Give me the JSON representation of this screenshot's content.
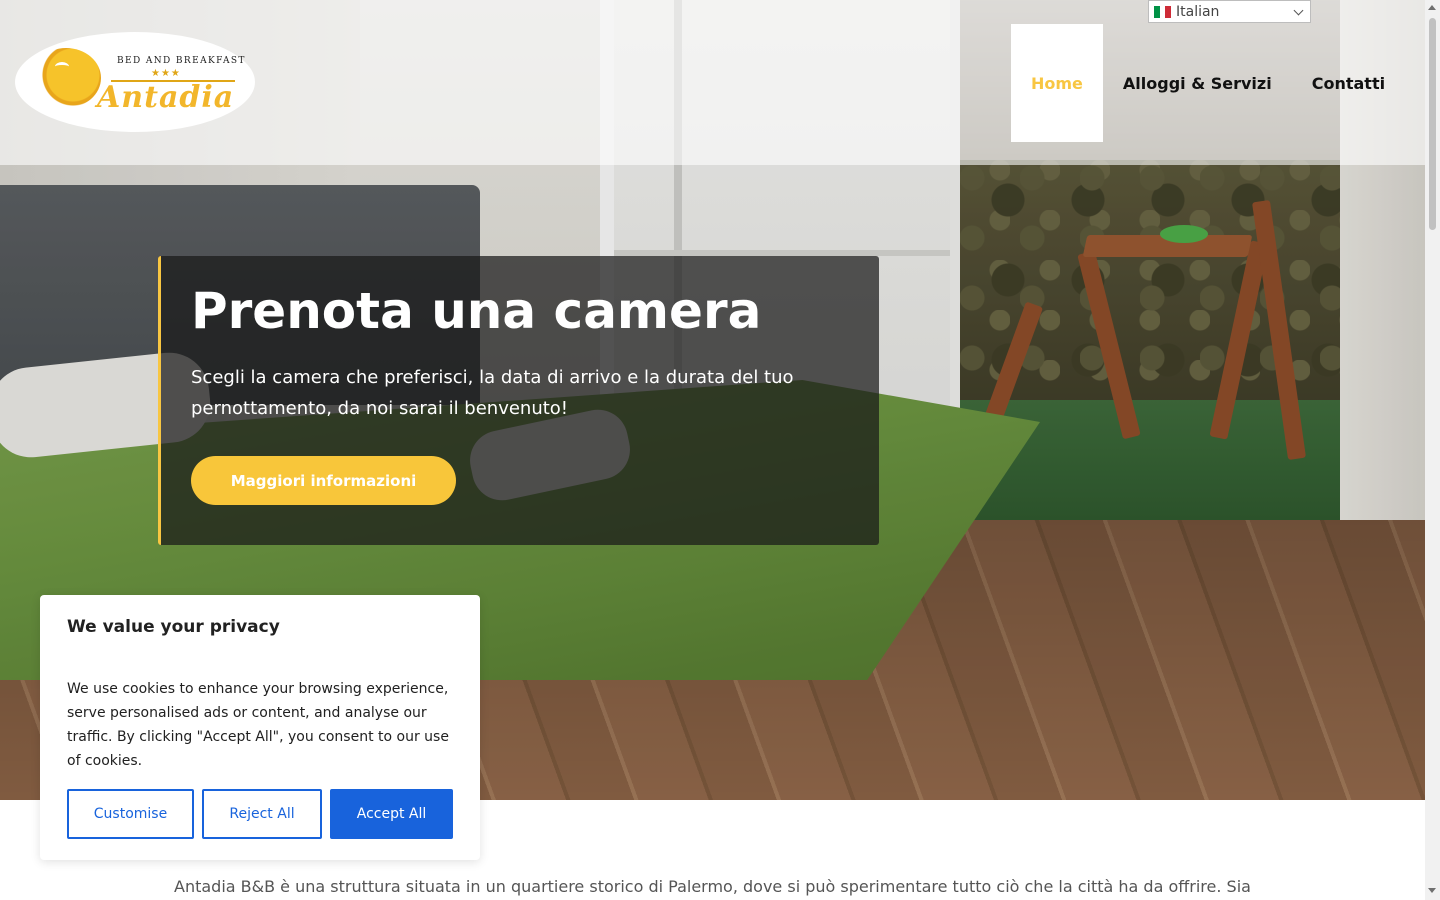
{
  "language_selector": {
    "selected": "Italian",
    "flag_colors": [
      "#009246",
      "#ffffff",
      "#ce2b37"
    ]
  },
  "logo": {
    "tagline": "Bed and Breakfast",
    "stars": "★★★",
    "name": "Antadia"
  },
  "nav": {
    "items": [
      {
        "label": "Home",
        "active": true
      },
      {
        "label": "Alloggi & Servizi",
        "active": false
      },
      {
        "label": "Contatti",
        "active": false
      }
    ]
  },
  "hero": {
    "title": "Prenota una camera",
    "subtitle": "Scegli la camera che preferisci, la data di arrivo e la durata del tuo pernottamento, da noi sarai il benvenuto!",
    "button_label": "Maggiori informazioni"
  },
  "intro": {
    "text": "Antadia B&B è una struttura situata in un quartiere storico di Palermo, dove si può sperimentare tutto ciò che la città ha da offrire. Sia"
  },
  "cookie_banner": {
    "title": "We value your privacy",
    "text": "We use cookies to enhance your browsing experience, serve personalised ads or content, and analyse our traffic. By clicking \"Accept All\", you consent to our use of cookies.",
    "customise_label": "Customise",
    "reject_label": "Reject All",
    "accept_label": "Accept All"
  },
  "colors": {
    "accent": "#f8c642",
    "cookie_primary": "#1863dc"
  }
}
